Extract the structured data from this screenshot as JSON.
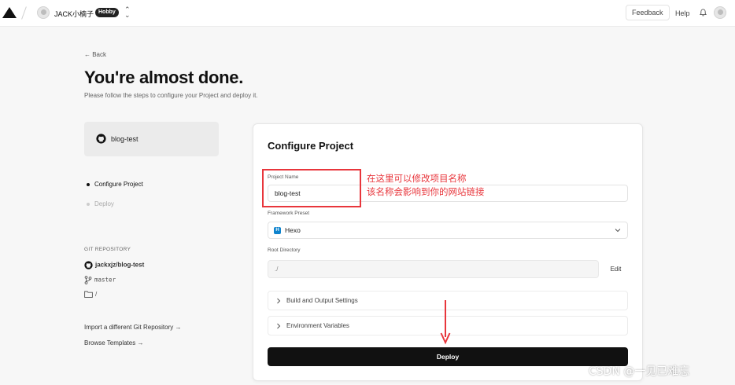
{
  "topbar": {
    "team_name": "JACK小楠子",
    "plan_badge": "Hobby",
    "switcher_icon": "chevron-up-down-icon",
    "feedback_label": "Feedback",
    "help_label": "Help"
  },
  "header": {
    "back_label": "← Back",
    "title": "You're almost done.",
    "subtitle": "Please follow the steps to configure your Project and deploy it."
  },
  "sidebar": {
    "repo_card_name": "blog-test",
    "steps": [
      {
        "label": "Configure Project",
        "active": true
      },
      {
        "label": "Deploy",
        "active": false
      }
    ],
    "git_heading": "GIT REPOSITORY",
    "git_repo": "jackxjz/blog-test",
    "git_branch": "master",
    "git_dir": "/",
    "import_link": "Import a different Git Repository →",
    "browse_link": "Browse Templates →"
  },
  "configure": {
    "title": "Configure Project",
    "project_name_label": "Project Name",
    "project_name_value": "blog-test",
    "framework_label": "Framework Preset",
    "framework_value": "Hexo",
    "framework_icon_letter": "H",
    "root_label": "Root Directory",
    "root_value": "./",
    "edit_label": "Edit",
    "build_settings_label": "Build and Output Settings",
    "env_vars_label": "Environment Variables",
    "deploy_label": "Deploy"
  },
  "annotations": {
    "line1": "在这里可以修改项目名称",
    "line2": "该名称会影响到你的网站链接",
    "color": "#e8363c"
  },
  "watermark": "CSDN @一见已难忘",
  "colors": {
    "accent": "#111111",
    "background": "#f7f7f7",
    "annotation": "#e8363c",
    "hexo": "#0e83cd"
  }
}
